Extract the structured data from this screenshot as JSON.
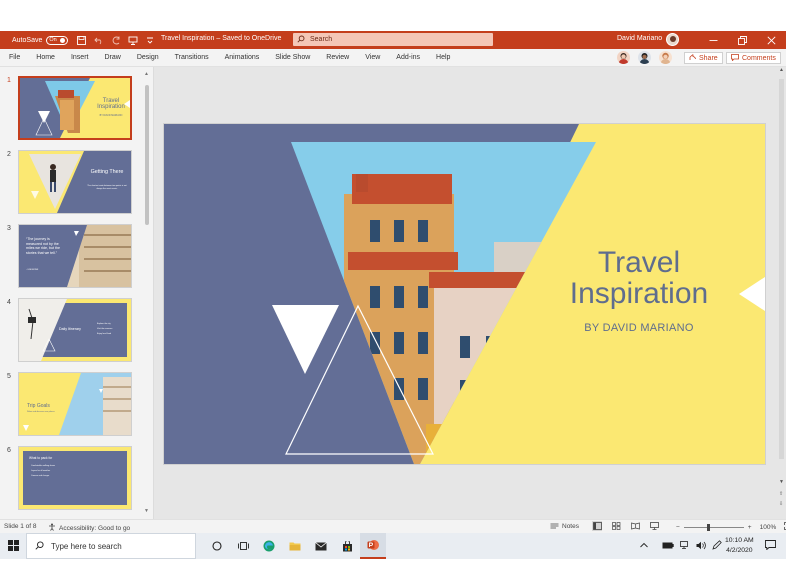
{
  "app": {
    "autosave_label": "AutoSave",
    "autosave_state": "On",
    "document_title": "Travel Inspiration – Saved to OneDrive",
    "search_placeholder": "Search",
    "user_name": "David Mariano",
    "brand_color": "#c43e1c"
  },
  "menu": {
    "items": [
      "File",
      "Home",
      "Insert",
      "Draw",
      "Design",
      "Transitions",
      "Animations",
      "Slide Show",
      "Review",
      "View",
      "Add-ins",
      "Help"
    ],
    "share_label": "Share",
    "comments_label": "Comments"
  },
  "thumbnails": {
    "numbers": [
      "1",
      "2",
      "3",
      "4",
      "5",
      "6"
    ],
    "slide1": {
      "title": "Travel Inspiration",
      "sub": "BY DAVID MARIANO"
    },
    "slide2": {
      "title": "Getting There",
      "body": "The shortest route between two points is not always the most scenic."
    },
    "slide3": {
      "quote": "“The journey is measured not by the miles we ride, but the stories that we tell.”",
      "cite": "– UNKNOWN"
    },
    "slide4": {
      "title": "Daily Itinerary",
      "items": [
        "Explore the city",
        "Visit the museum",
        "Enjoy local food"
      ]
    },
    "slide5": {
      "title": "Trip Goals",
      "body": "Relax and discover new places"
    },
    "slide6": {
      "title": "What to pack for",
      "items": [
        "Comfortable walking shoes",
        "Layers for all weather",
        "Camera and charger"
      ]
    }
  },
  "slide": {
    "title_line1": "Travel",
    "title_line2": "Inspiration",
    "subtitle": "BY DAVID MARIANO",
    "colors": {
      "slate": "#636e96",
      "yellow": "#fbe872",
      "sky": "#7ec9e8"
    }
  },
  "status": {
    "slide_position": "Slide 1 of 8",
    "accessibility": "Accessibility: Good to go",
    "notes_label": "Notes",
    "zoom_level": "100%"
  },
  "taskbar": {
    "search_placeholder": "Type here to search",
    "time": "10:10 AM",
    "date": "4/2/2020"
  }
}
